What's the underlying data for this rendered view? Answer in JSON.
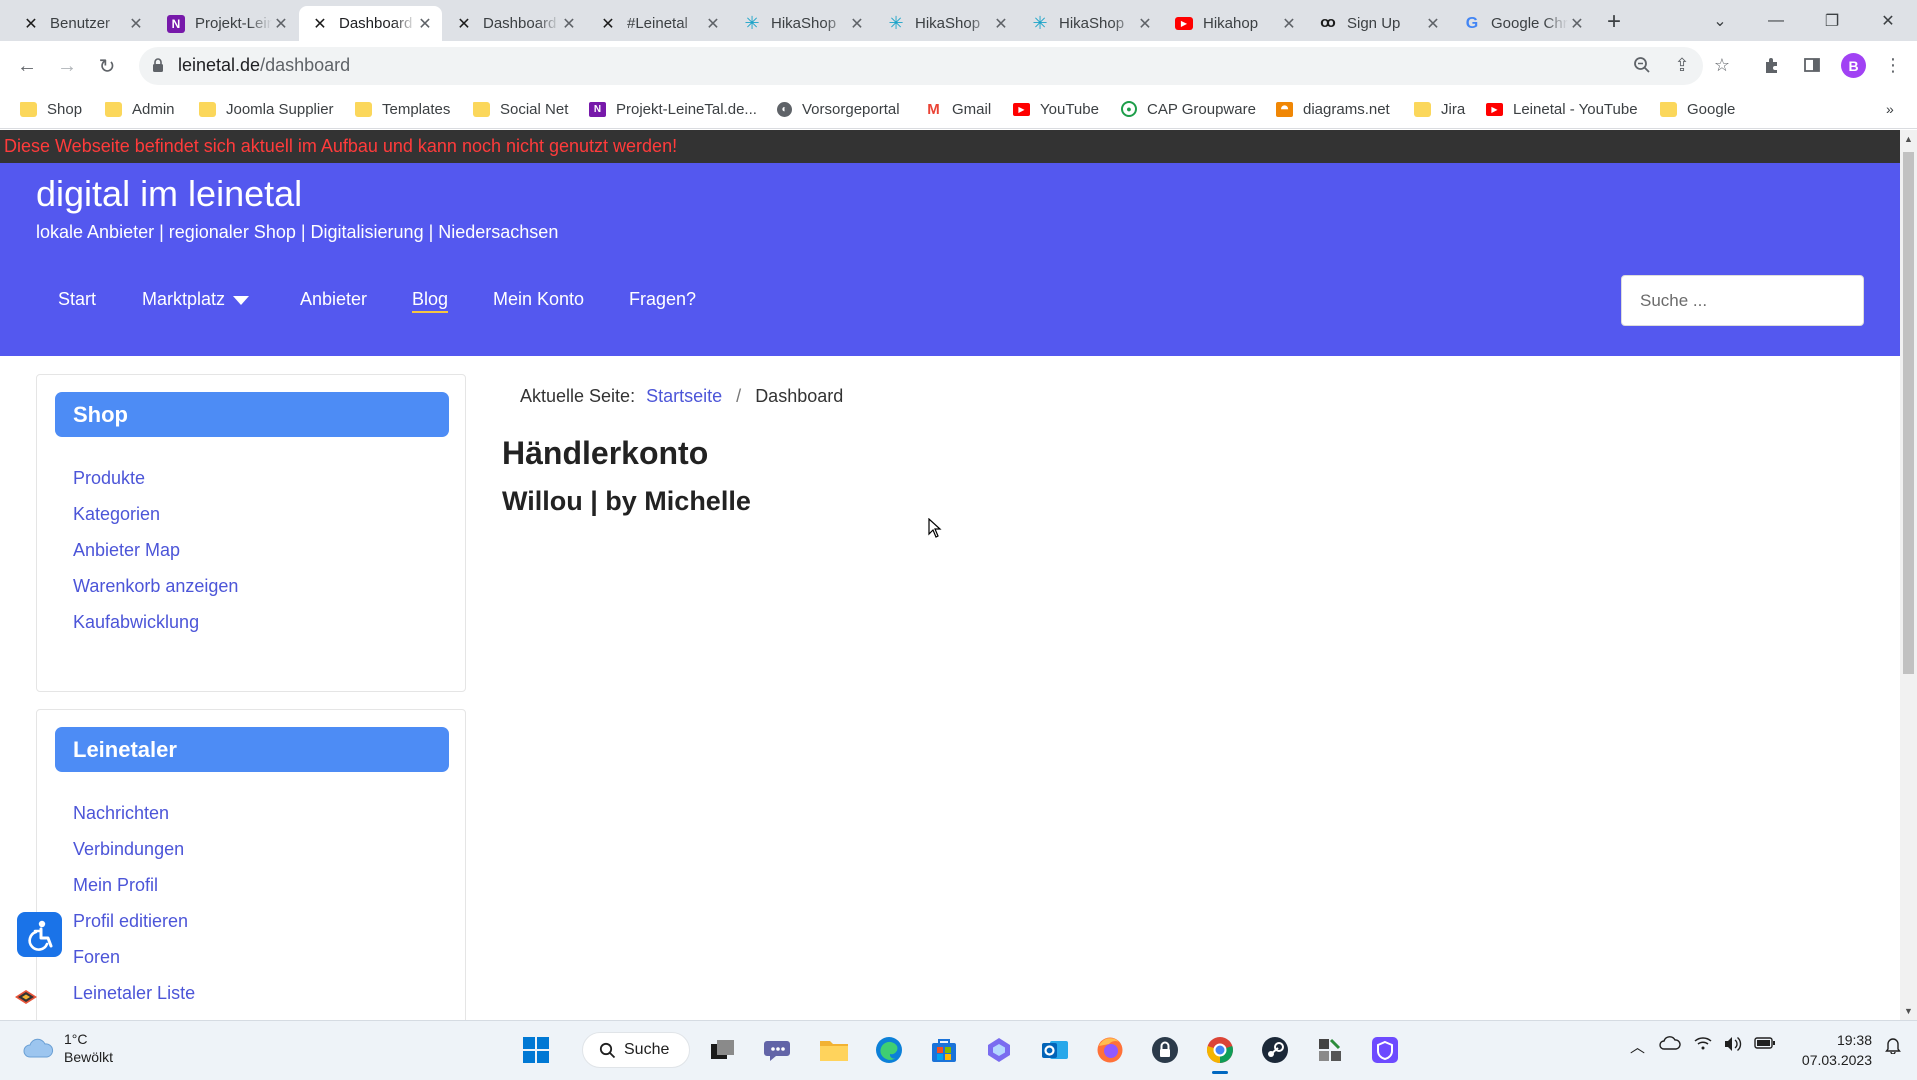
{
  "browser": {
    "tabs": [
      {
        "title": "Benutzer",
        "icon": "joomla-icon"
      },
      {
        "title": "Projekt-LeineTal",
        "icon": "onenote-icon"
      },
      {
        "title": "Dashboard",
        "icon": "joomla-icon",
        "active": true
      },
      {
        "title": "Dashboard",
        "icon": "joomla-icon"
      },
      {
        "title": "#Leinetal",
        "icon": "joomla-icon"
      },
      {
        "title": "HikaShop",
        "icon": "hikashop-icon"
      },
      {
        "title": "HikaShop",
        "icon": "hikashop-icon"
      },
      {
        "title": "HikaShop",
        "icon": "hikashop-icon"
      },
      {
        "title": "Hikahop",
        "icon": "youtube-icon"
      },
      {
        "title": "Sign Up",
        "icon": "woo-icon"
      },
      {
        "title": "Google Chrome",
        "icon": "google-icon"
      }
    ],
    "url_host": "leinetal.de",
    "url_path": "/dashboard",
    "profile_initial": "B",
    "bookmarks": [
      {
        "label": "Shop",
        "icon": "folder-icon"
      },
      {
        "label": "Admin",
        "icon": "folder-icon"
      },
      {
        "label": "Joomla Supplier",
        "icon": "folder-icon"
      },
      {
        "label": "Templates",
        "icon": "folder-icon"
      },
      {
        "label": "Social Net",
        "icon": "folder-icon"
      },
      {
        "label": "Projekt-LeineTal.de...",
        "icon": "onenote-icon"
      },
      {
        "label": "Vorsorgeportal",
        "icon": "globe-icon"
      },
      {
        "label": "Gmail",
        "icon": "gmail-icon"
      },
      {
        "label": "YouTube",
        "icon": "youtube-icon"
      },
      {
        "label": "CAP Groupware",
        "icon": "cap-icon"
      },
      {
        "label": "diagrams.net",
        "icon": "diagrams-icon"
      },
      {
        "label": "Jira",
        "icon": "folder-icon"
      },
      {
        "label": "Leinetal - YouTube",
        "icon": "youtube-icon"
      },
      {
        "label": "Google",
        "icon": "folder-icon"
      }
    ]
  },
  "page": {
    "notice": "Diese Webseite befindet sich aktuell im Aufbau und kann noch nicht genutzt werden!",
    "site_title": "digital im leinetal",
    "tagline": "lokale Anbieter | regionaler Shop | Digitalisierung | Niedersachsen",
    "menu": {
      "start": "Start",
      "marktplatz": "Marktplatz",
      "anbieter": "Anbieter",
      "blog": "Blog",
      "mein_konto": "Mein Konto",
      "fragen": "Fragen?"
    },
    "search_placeholder": "Suche ...",
    "sidebar": {
      "shop": {
        "title": "Shop",
        "links": [
          "Produkte",
          "Kategorien",
          "Anbieter Map",
          "Warenkorb anzeigen",
          "Kaufabwicklung"
        ]
      },
      "leinetaler": {
        "title": "Leinetaler",
        "links": [
          "Nachrichten",
          "Verbindungen",
          "Mein Profil",
          "Profil editieren",
          "Foren",
          "Leinetaler Liste"
        ]
      }
    },
    "breadcrumb": {
      "label": "Aktuelle Seite:",
      "home": "Startseite",
      "separator": "/",
      "current": "Dashboard"
    },
    "heading": "Händlerkonto",
    "subheading": "Willou | by Michelle"
  },
  "taskbar": {
    "weather_temp": "1°C",
    "weather_desc": "Bewölkt",
    "search_label": "Suche",
    "time": "19:38",
    "date": "07.03.2023"
  },
  "colors": {
    "header_bg": "#5458ef",
    "notice_bg": "#333333",
    "notice_text": "#ff3b3b",
    "card_title_bg": "#4d8cf5",
    "link": "#4c55d8",
    "active_menu_underline": "#f4c542"
  }
}
